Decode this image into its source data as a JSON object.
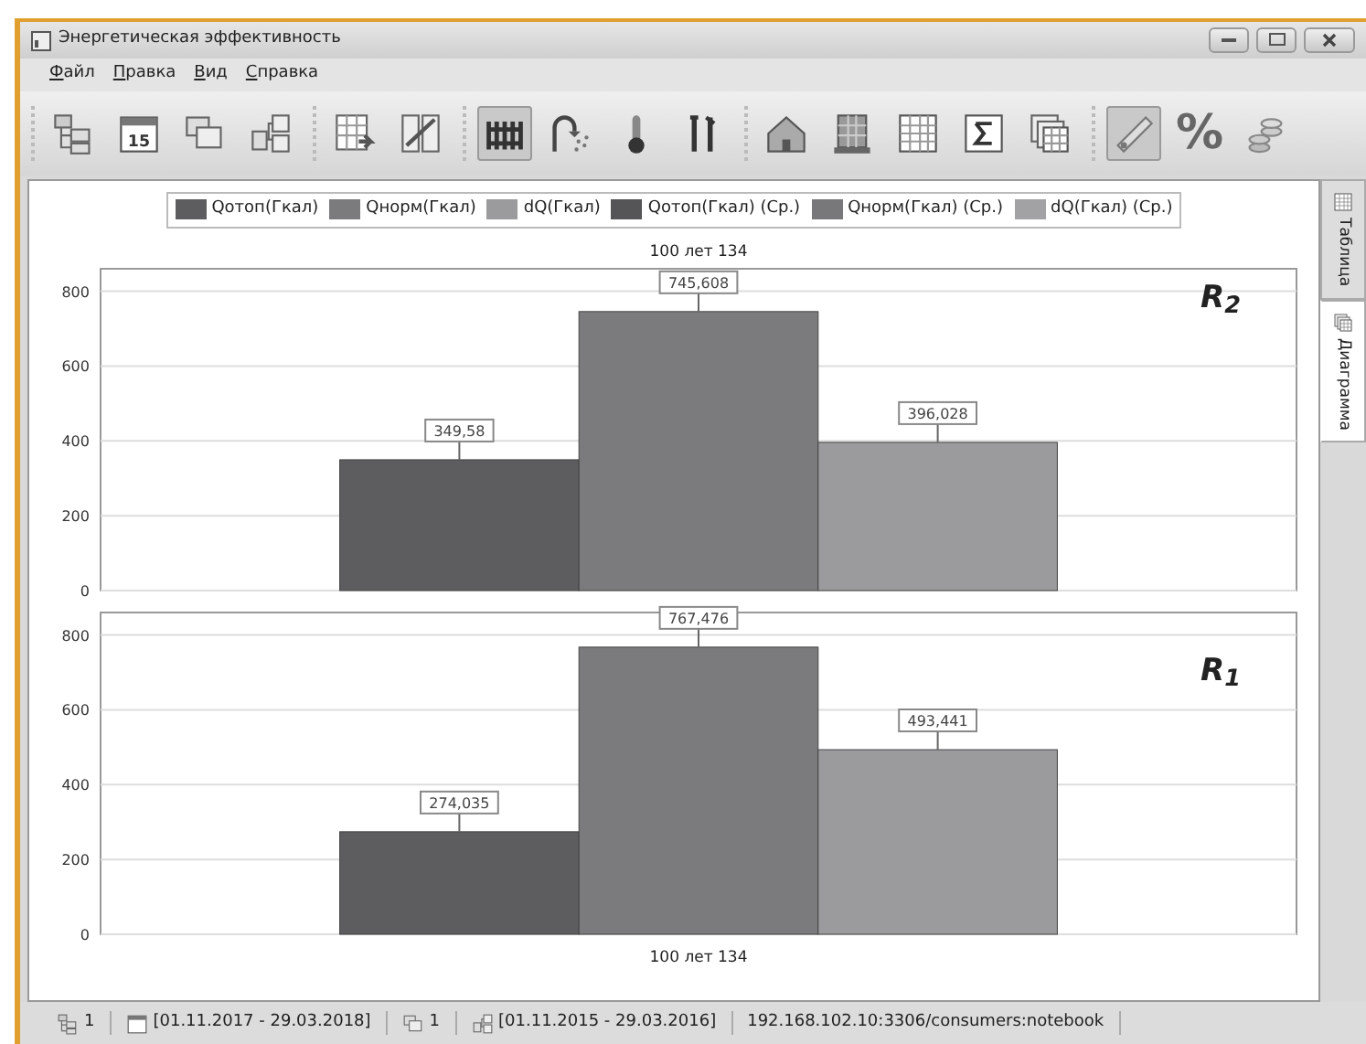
{
  "window": {
    "title": "Энергетическая эффективность"
  },
  "menu": [
    "Файл",
    "Правка",
    "Вид",
    "Справка"
  ],
  "toolbar": {
    "groups": [
      [
        {
          "kind": "tree",
          "pressed": false
        },
        {
          "kind": "calendar",
          "text": "15",
          "pressed": false
        },
        {
          "kind": "copy",
          "pressed": false
        },
        {
          "kind": "tree-tools",
          "pressed": false
        }
      ],
      [
        {
          "kind": "table-export",
          "pressed": false
        },
        {
          "kind": "split",
          "pressed": false
        }
      ],
      [
        {
          "kind": "radiator",
          "pressed": true
        },
        {
          "kind": "shower",
          "pressed": false
        },
        {
          "kind": "thermometer",
          "pressed": false
        },
        {
          "kind": "tools",
          "pressed": false
        }
      ],
      [
        {
          "kind": "house",
          "pressed": false
        },
        {
          "kind": "building",
          "pressed": false
        },
        {
          "kind": "grid",
          "pressed": false
        },
        {
          "kind": "sum",
          "pressed": false
        },
        {
          "kind": "tables",
          "pressed": false
        }
      ],
      [
        {
          "kind": "ruler",
          "pressed": true
        },
        {
          "kind": "text",
          "text": "%",
          "pressed": false
        },
        {
          "kind": "coins",
          "pressed": false
        }
      ]
    ]
  },
  "charts": [
    {
      "chart_data": {
        "type": "bar",
        "categories": [
          "100 лет 134"
        ],
        "ylim": [
          0,
          860
        ],
        "yticks": [
          0,
          200,
          400,
          600,
          800
        ],
        "value_labels": [
          "349,58",
          "745,608",
          "396,028"
        ],
        "grid": true,
        "annotations": [
          "R$_{2}$"
        ],
        "series": [
          {
            "name": "Qотоп(Гкал)",
            "color": "#5d5d5f",
            "values": [
              349.58
            ]
          },
          {
            "name": "Qнорм(Гкал)",
            "color": "#7b7b7d",
            "values": [
              745.608
            ]
          },
          {
            "name": "dQ(Гкал)",
            "color": "#9b9b9d",
            "values": [
              396.028
            ]
          },
          {
            "name": "Qотоп(Гкал) (Ср.)",
            "color": "#555557",
            "values": [
              null
            ]
          },
          {
            "name": "Qнорм(Гкал) (Ср.)",
            "color": "#78787a",
            "values": [
              null
            ]
          },
          {
            "name": "dQ(Гкал) (Ср.)",
            "color": "#a2a2a4",
            "values": [
              null
            ]
          }
        ]
      }
    },
    {
      "chart_data": {
        "type": "bar",
        "categories": [
          "100 лет 134"
        ],
        "ylim": [
          0,
          860
        ],
        "yticks": [
          0,
          200,
          400,
          600,
          800
        ],
        "value_labels": [
          "274,035",
          "767,476",
          "493,441"
        ],
        "grid": true,
        "annotations": [
          "R$_{1}$"
        ],
        "series": [
          {
            "color": "#5d5d5f",
            "values": [
              274.035
            ]
          },
          {
            "color": "#7b7b7d",
            "values": [
              767.476
            ]
          },
          {
            "color": "#9b9b9d",
            "values": [
              493.441
            ]
          }
        ]
      }
    }
  ],
  "side_tabs": [
    {
      "label": "Таблица",
      "selected": false
    },
    {
      "label": "Диаграмма",
      "selected": true
    }
  ],
  "status_bar": [
    {
      "kind": "tree",
      "text": "1"
    },
    {
      "kind": "calendar",
      "text": "[01.11.2017 - 29.03.2018]"
    },
    {
      "kind": "copy",
      "text": "1"
    },
    {
      "kind": "tree-tools",
      "text": "[01.11.2015 - 29.03.2016]"
    },
    {
      "kind": "none",
      "text": "192.168.102.10:3306/consumers:notebook"
    }
  ]
}
